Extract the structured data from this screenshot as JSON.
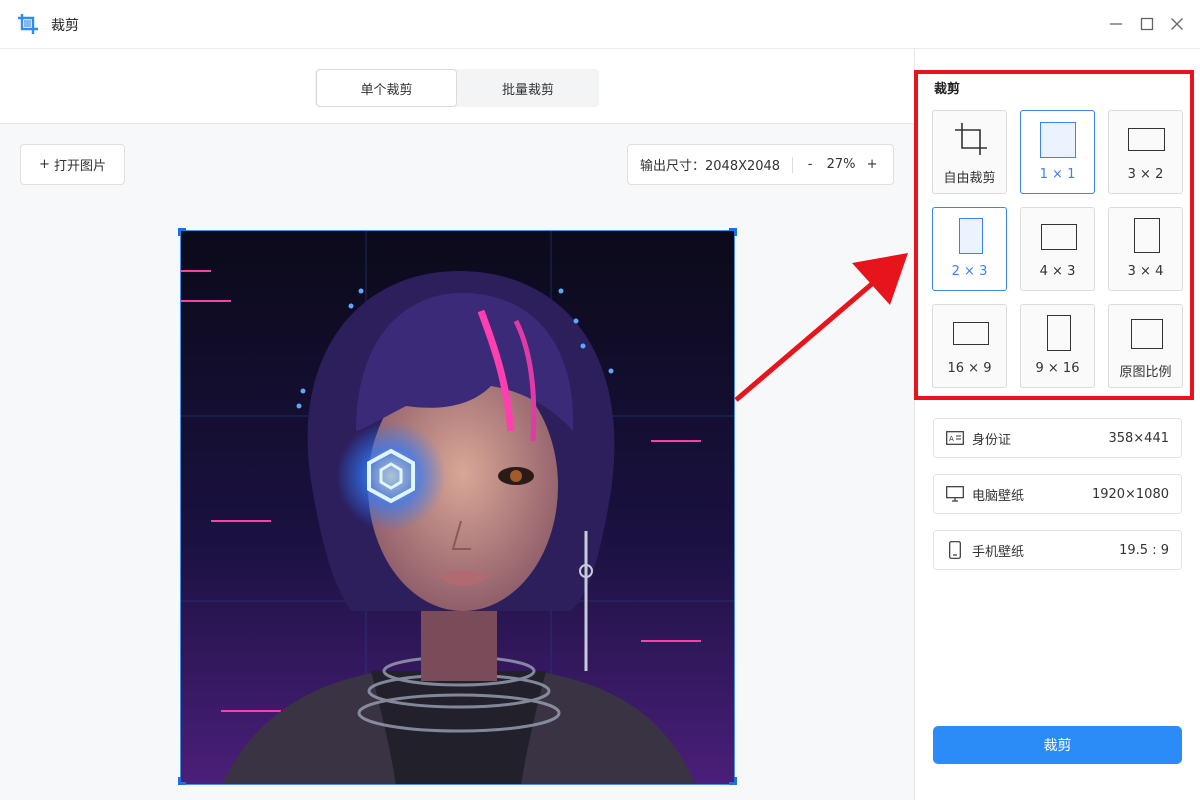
{
  "window": {
    "title": "裁剪"
  },
  "tabs": {
    "single": "单个裁剪",
    "batch": "批量裁剪"
  },
  "toolbar": {
    "open_label": "打开图片",
    "output_label": "输出尺寸：2048X2048",
    "zoom_out": "-",
    "zoom_value": "27%",
    "zoom_in": "+"
  },
  "panel": {
    "section_title": "裁剪",
    "ratios": [
      {
        "label": "自由裁剪",
        "selected": false
      },
      {
        "label": "1 × 1",
        "selected": true
      },
      {
        "label": "3 × 2",
        "selected": false
      },
      {
        "label": "2 × 3",
        "selected": true
      },
      {
        "label": "4 × 3",
        "selected": false
      },
      {
        "label": "3 × 4",
        "selected": false
      },
      {
        "label": "16 × 9",
        "selected": false
      },
      {
        "label": "9 × 16",
        "selected": false
      },
      {
        "label": "原图比例",
        "selected": false
      }
    ],
    "presets": [
      {
        "name": "身份证",
        "value": "358×441",
        "icon": "id-card-icon"
      },
      {
        "name": "电脑壁纸",
        "value": "1920×1080",
        "icon": "monitor-icon"
      },
      {
        "name": "手机壁纸",
        "value": "19.5 : 9",
        "icon": "phone-icon"
      }
    ],
    "crop_button": "裁剪"
  },
  "colors": {
    "accent": "#2b8cf7",
    "highlight": "#e8141b",
    "selected_border": "#3b82f6"
  }
}
